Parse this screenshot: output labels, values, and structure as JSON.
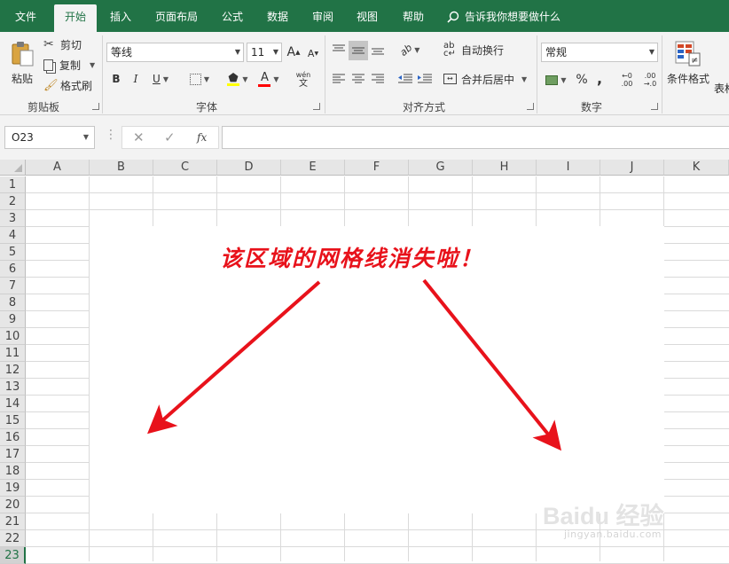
{
  "tabs": [
    "文件",
    "开始",
    "插入",
    "页面布局",
    "公式",
    "数据",
    "审阅",
    "视图",
    "帮助"
  ],
  "tell_me": "告诉我你想要做什么",
  "clipboard": {
    "paste": "粘贴",
    "cut": "剪切",
    "copy": "复制",
    "format_painter": "格式刷",
    "label": "剪贴板"
  },
  "font": {
    "name": "等线",
    "size": "11",
    "grow": "A",
    "shrink": "A",
    "bold": "B",
    "italic": "I",
    "underline": "U",
    "font_color_letter": "A",
    "phonetic_top": "wén",
    "phonetic_bottom": "文",
    "label": "字体"
  },
  "alignment": {
    "wrap_text": "自动换行",
    "merge_center": "合并后居中",
    "label": "对齐方式",
    "orientation_glyph": "ab"
  },
  "number": {
    "format": "常规",
    "percent": "%",
    "comma": ",",
    "inc_decimal_top": "←0",
    "inc_decimal_bottom": ".00",
    "dec_decimal_top": ".00",
    "dec_decimal_bottom": "→.0",
    "label": "数字"
  },
  "styles": {
    "conditional_format": "条件格式",
    "table_format": "表格"
  },
  "name_box": "O23",
  "formula_buttons": {
    "cancel": "✕",
    "enter": "✓",
    "function": "fx"
  },
  "columns": [
    "A",
    "B",
    "C",
    "D",
    "E",
    "F",
    "G",
    "H",
    "I",
    "J",
    "K"
  ],
  "rows": [
    "1",
    "2",
    "3",
    "4",
    "5",
    "6",
    "7",
    "8",
    "9",
    "10",
    "11",
    "12",
    "13",
    "14",
    "15",
    "16",
    "17",
    "18",
    "19",
    "20",
    "21",
    "22",
    "23"
  ],
  "annotation": "该区域的网格线消失啦！",
  "watermark": {
    "brand": "Baidu 经验",
    "url": "jingyan.baidu.com"
  },
  "colors": {
    "accent": "#217346",
    "annotation": "#e8121b",
    "font_color_bar": "#ff0000",
    "gridline": "#dadada"
  }
}
